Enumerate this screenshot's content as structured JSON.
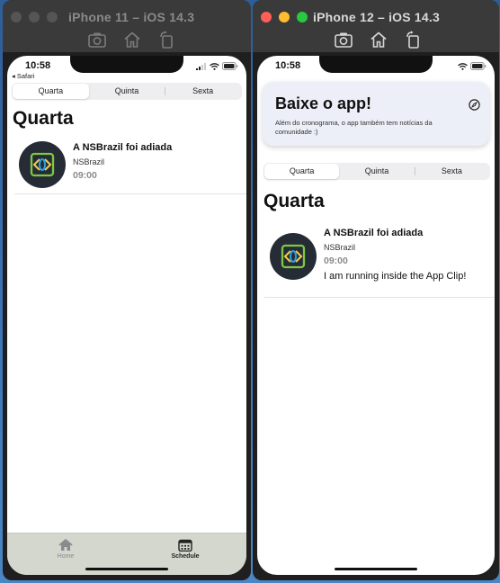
{
  "colors": {
    "desktop": "#3a6fae",
    "titlebar": "#3a3a3a",
    "light_red": "#fe5f57",
    "light_yellow": "#febc2e",
    "light_green": "#28c840",
    "light_inactive": "#555555",
    "tabbar": "#d3d7cd",
    "time_gray": "#8a8a8e",
    "logo_green": "#7fc843",
    "logo_blue": "#2b9fe0",
    "banner_bg": "#eceff7"
  },
  "left_sim": {
    "title": "iPhone 11 – iOS 14.3",
    "toolbar_icons": [
      "screenshot-icon",
      "home-icon",
      "rotate-icon"
    ],
    "status": {
      "time": "10:58",
      "back_label": "◂ Safari",
      "icons": [
        "signal-icon",
        "wifi-icon",
        "battery-icon"
      ]
    },
    "segments": [
      "Quarta",
      "Quinta",
      "Sexta"
    ],
    "selected_segment": "Quarta",
    "heading": "Quarta",
    "event": {
      "icon": "nsbrazil-logo-icon",
      "title": "A NSBrazil foi adiada",
      "author": "NSBrazil",
      "time": "09:00"
    },
    "tabs": [
      {
        "label": "Home",
        "icon": "house-icon",
        "selected": false
      },
      {
        "label": "Schedule",
        "icon": "calendar-icon",
        "selected": true
      }
    ]
  },
  "right_sim": {
    "title": "iPhone 12 – iOS 14.3",
    "toolbar_icons": [
      "screenshot-icon",
      "home-icon",
      "rotate-icon"
    ],
    "status": {
      "time": "10:58",
      "icons": [
        "wifi-icon",
        "battery-icon"
      ]
    },
    "banner": {
      "title": "Baixe o app!",
      "text": "Além do cronograma, o app também tem notícias da comunidade :)",
      "icon": "compass-icon"
    },
    "segments": [
      "Quarta",
      "Quinta",
      "Sexta"
    ],
    "selected_segment": "Quarta",
    "heading": "Quarta",
    "event": {
      "icon": "nsbrazil-logo-icon",
      "title": "A NSBrazil foi adiada",
      "author": "NSBrazil",
      "time": "09:00",
      "note": "I am running inside the App Clip!"
    }
  }
}
